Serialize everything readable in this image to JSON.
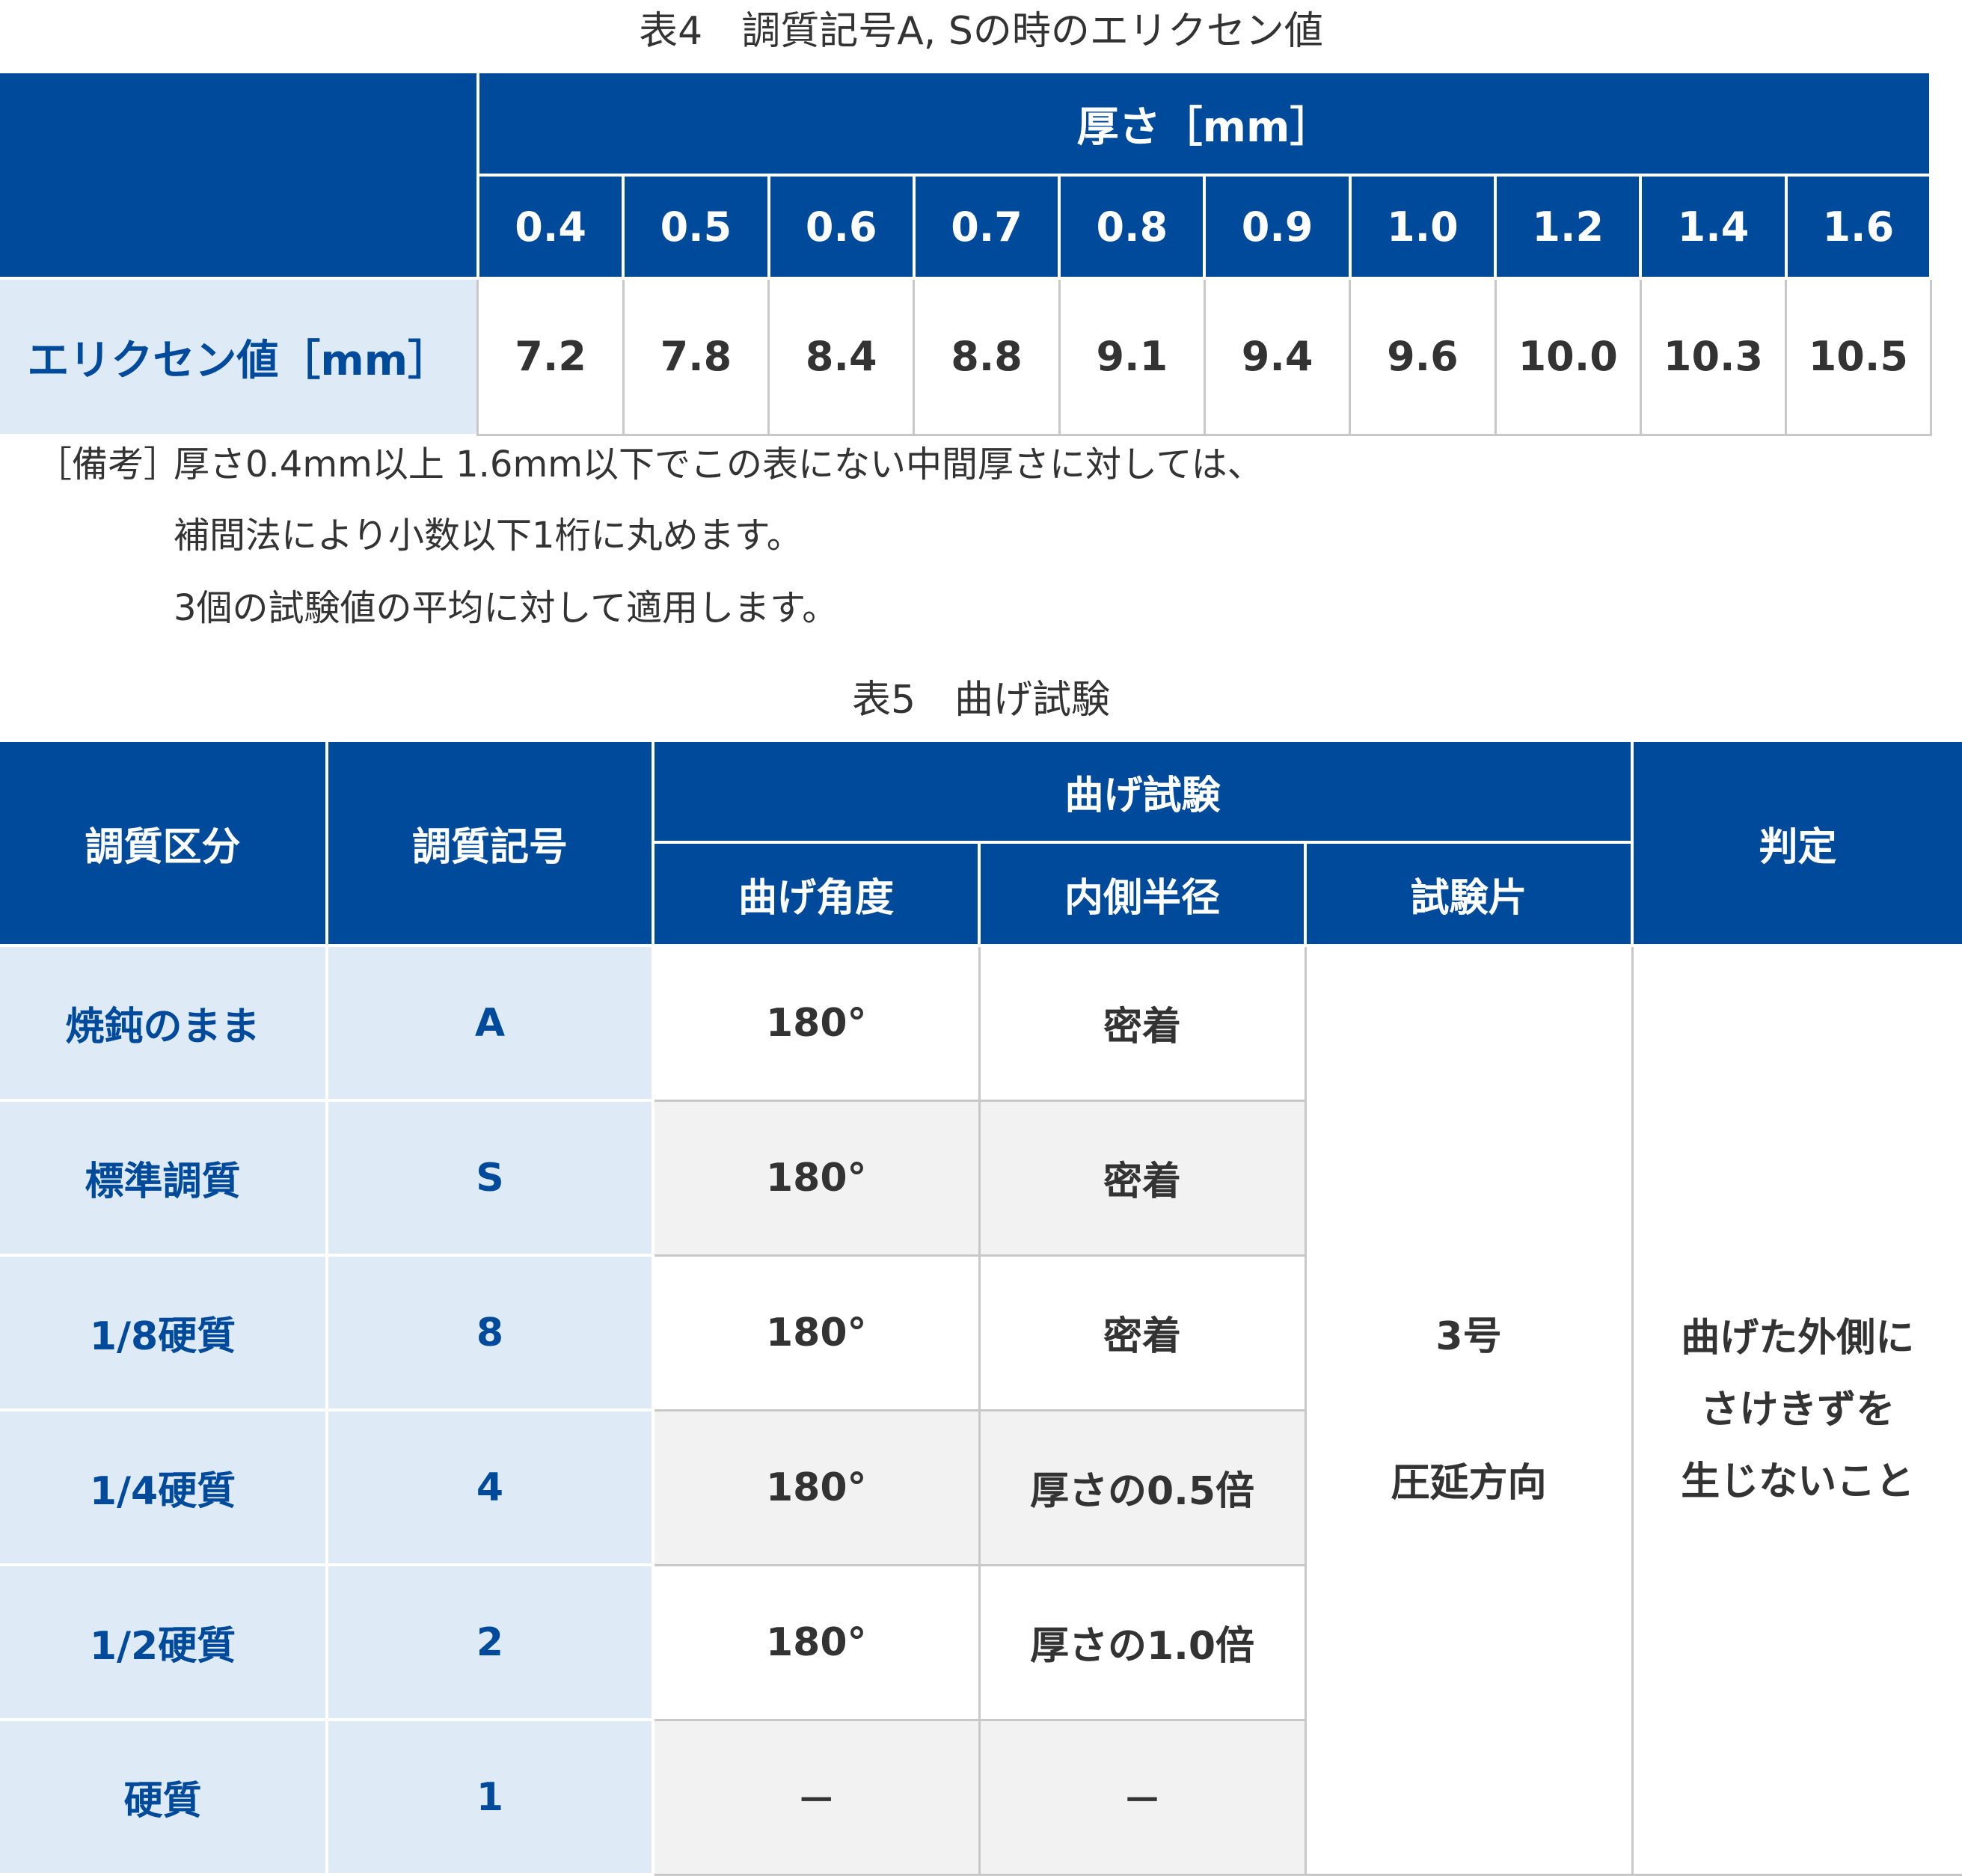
{
  "table4": {
    "caption": "表4　調質記号A, Sの時のエリクセン値",
    "header_group": "厚さ［mm］",
    "thicknesses": [
      "0.4",
      "0.5",
      "0.6",
      "0.7",
      "0.8",
      "0.9",
      "1.0",
      "1.2",
      "1.4",
      "1.6"
    ],
    "row_label": "エリクセン値［mm］",
    "values": [
      "7.2",
      "7.8",
      "8.4",
      "8.8",
      "9.1",
      "9.4",
      "9.6",
      "10.0",
      "10.3",
      "10.5"
    ]
  },
  "remarks": {
    "label": "［備考］",
    "lines": [
      "厚さ0.4mm以上 1.6mm以下でこの表にない中間厚さに対しては、",
      "補間法により小数以下1桁に丸めます。",
      "3個の試験値の平均に対して適用します。"
    ]
  },
  "table5": {
    "caption": "表5　曲げ試験",
    "headers": {
      "temper_class": "調質区分",
      "temper_symbol": "調質記号",
      "bend_test": "曲げ試験",
      "bend_angle": "曲げ角度",
      "inner_radius": "内側半径",
      "specimen": "試験片",
      "judgement": "判定"
    },
    "rows": [
      {
        "temper_class": "焼鈍のまま",
        "symbol": "A",
        "angle": "180°",
        "radius": "密着"
      },
      {
        "temper_class": "標準調質",
        "symbol": "S",
        "angle": "180°",
        "radius": "密着"
      },
      {
        "temper_class": "1/8硬質",
        "symbol": "8",
        "angle": "180°",
        "radius": "密着"
      },
      {
        "temper_class": "1/4硬質",
        "symbol": "4",
        "angle": "180°",
        "radius": "厚さの0.5倍"
      },
      {
        "temper_class": "1/2硬質",
        "symbol": "2",
        "angle": "180°",
        "radius": "厚さの1.0倍"
      },
      {
        "temper_class": "硬質",
        "symbol": "1",
        "angle": "－",
        "radius": "－"
      }
    ],
    "specimen_lines": [
      "3号",
      "圧延方向"
    ],
    "judgement_lines": [
      "曲げた外側に",
      "さけきずを",
      "生じないこと"
    ]
  },
  "colors": {
    "header_bg": "#004a9c",
    "label_bg": "#deeaf6",
    "label_text": "#004a9c",
    "alt_row_bg": "#f2f2f2"
  }
}
